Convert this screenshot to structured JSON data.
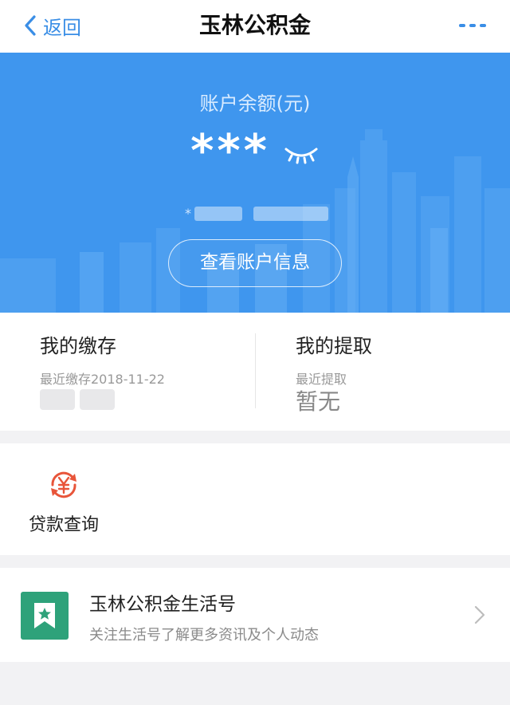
{
  "nav": {
    "back_label": "返回",
    "title": "玉林公积金"
  },
  "hero": {
    "balance_label": "账户余额(元)",
    "balance_masked": "***",
    "masked_prefix": "*",
    "account_info_button": "查看账户信息"
  },
  "summary": {
    "deposit": {
      "title": "我的缴存",
      "subtitle": "最近缴存2018-11-22"
    },
    "withdraw": {
      "title": "我的提取",
      "subtitle": "最近提取",
      "value": "暂无"
    }
  },
  "services": {
    "items": [
      {
        "label": "贷款查询",
        "icon": "loan-yuan-icon",
        "color": "#e8553a"
      }
    ]
  },
  "life_account": {
    "title": "玉林公积金生活号",
    "description": "关注生活号了解更多资讯及个人动态",
    "badge_color": "#2ea27a"
  },
  "colors": {
    "accent": "#3a8ee6",
    "hero_bg": "#3f96ee",
    "page_bg": "#f2f2f4"
  }
}
